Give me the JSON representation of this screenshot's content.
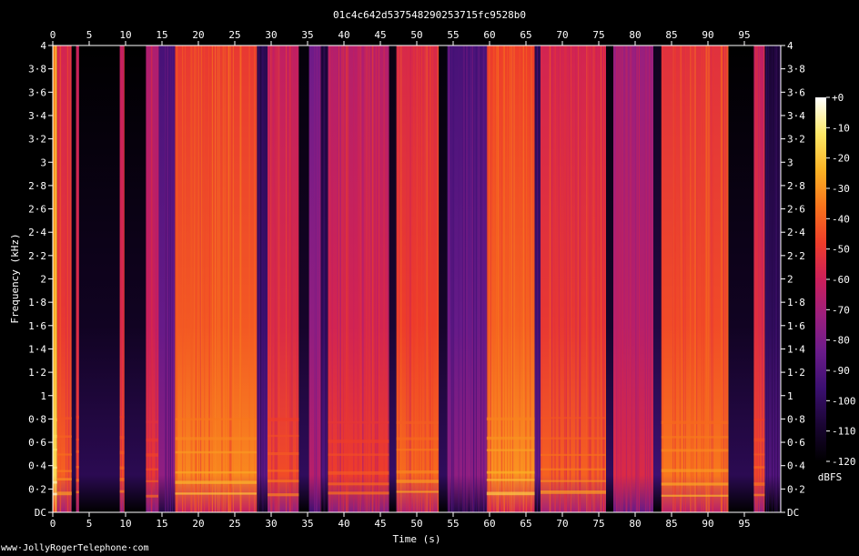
{
  "chart_data": {
    "type": "heatmap",
    "title": "01c4c642d537548290253715fc9528b0",
    "xlabel": "Time (s)",
    "ylabel": "Frequency (kHz)",
    "xlim": [
      0,
      100
    ],
    "ylim": [
      0,
      4
    ],
    "x_ticks": [
      "0",
      "5",
      "10",
      "15",
      "20",
      "25",
      "30",
      "35",
      "40",
      "45",
      "50",
      "55",
      "60",
      "65",
      "70",
      "75",
      "80",
      "85",
      "90",
      "95"
    ],
    "x_tick_values": [
      0,
      5,
      10,
      15,
      20,
      25,
      30,
      35,
      40,
      45,
      50,
      55,
      60,
      65,
      70,
      75,
      80,
      85,
      90,
      95
    ],
    "y_ticks": [
      "DC",
      "0·2",
      "0·4",
      "0·6",
      "0·8",
      "1",
      "1·2",
      "1·4",
      "1·6",
      "1·8",
      "2",
      "2·2",
      "2·4",
      "2·6",
      "2·8",
      "3",
      "3·2",
      "3·4",
      "3·6",
      "3·8",
      "4"
    ],
    "y_tick_values": [
      0,
      0.2,
      0.4,
      0.6,
      0.8,
      1,
      1.2,
      1.4,
      1.6,
      1.8,
      2,
      2.2,
      2.4,
      2.6,
      2.8,
      3,
      3.2,
      3.4,
      3.6,
      3.8,
      4
    ],
    "colorbar": {
      "label": "dBFS",
      "ticks": [
        "+0",
        "-10",
        "-20",
        "-30",
        "-40",
        "-50",
        "-60",
        "-70",
        "-80",
        "-90",
        "-100",
        "-110",
        "-120"
      ],
      "tick_values": [
        0,
        -10,
        -20,
        -30,
        -40,
        -50,
        -60,
        -70,
        -80,
        -90,
        -100,
        -110,
        -120
      ],
      "range": [
        -120,
        0
      ],
      "colors": [
        "#000000",
        "#1a0533",
        "#3b0f70",
        "#6a1b8a",
        "#9c1f7e",
        "#cc1f5a",
        "#ee3d2a",
        "#f8731c",
        "#fbb325",
        "#fde867",
        "#ffffff"
      ]
    },
    "segments": [
      {
        "start": 0,
        "end": 0.6,
        "level": -25
      },
      {
        "start": 0.6,
        "end": 2.6,
        "level": -50
      },
      {
        "start": 2.6,
        "end": 3.2,
        "level": -112
      },
      {
        "start": 3.2,
        "end": 3.6,
        "level": -55
      },
      {
        "start": 3.6,
        "end": 9.2,
        "level": -112
      },
      {
        "start": 9.2,
        "end": 9.8,
        "level": -55
      },
      {
        "start": 9.8,
        "end": 12.8,
        "level": -112
      },
      {
        "start": 12.8,
        "end": 14.5,
        "level": -60
      },
      {
        "start": 14.5,
        "end": 16.8,
        "level": -85
      },
      {
        "start": 16.8,
        "end": 28.0,
        "level": -42
      },
      {
        "start": 28.0,
        "end": 29.5,
        "level": -95
      },
      {
        "start": 29.5,
        "end": 33.8,
        "level": -55
      },
      {
        "start": 33.8,
        "end": 35.2,
        "level": -110
      },
      {
        "start": 35.2,
        "end": 36.8,
        "level": -75
      },
      {
        "start": 36.8,
        "end": 37.8,
        "level": -100
      },
      {
        "start": 37.8,
        "end": 46.2,
        "level": -58
      },
      {
        "start": 46.2,
        "end": 47.2,
        "level": -108
      },
      {
        "start": 47.2,
        "end": 53.0,
        "level": -48
      },
      {
        "start": 53.0,
        "end": 54.2,
        "level": -110
      },
      {
        "start": 54.2,
        "end": 59.6,
        "level": -85
      },
      {
        "start": 59.6,
        "end": 66.2,
        "level": -40
      },
      {
        "start": 66.2,
        "end": 67.0,
        "level": -95
      },
      {
        "start": 67.0,
        "end": 76.0,
        "level": -50
      },
      {
        "start": 76.0,
        "end": 77.0,
        "level": -110
      },
      {
        "start": 77.0,
        "end": 82.5,
        "level": -65
      },
      {
        "start": 82.5,
        "end": 83.6,
        "level": -105
      },
      {
        "start": 83.6,
        "end": 92.8,
        "level": -45
      },
      {
        "start": 92.8,
        "end": 96.3,
        "level": -112
      },
      {
        "start": 96.3,
        "end": 97.8,
        "level": -55
      },
      {
        "start": 97.8,
        "end": 100,
        "level": -100
      }
    ]
  },
  "footer": {
    "watermark": "www·JollyRogerTelephone·com"
  }
}
